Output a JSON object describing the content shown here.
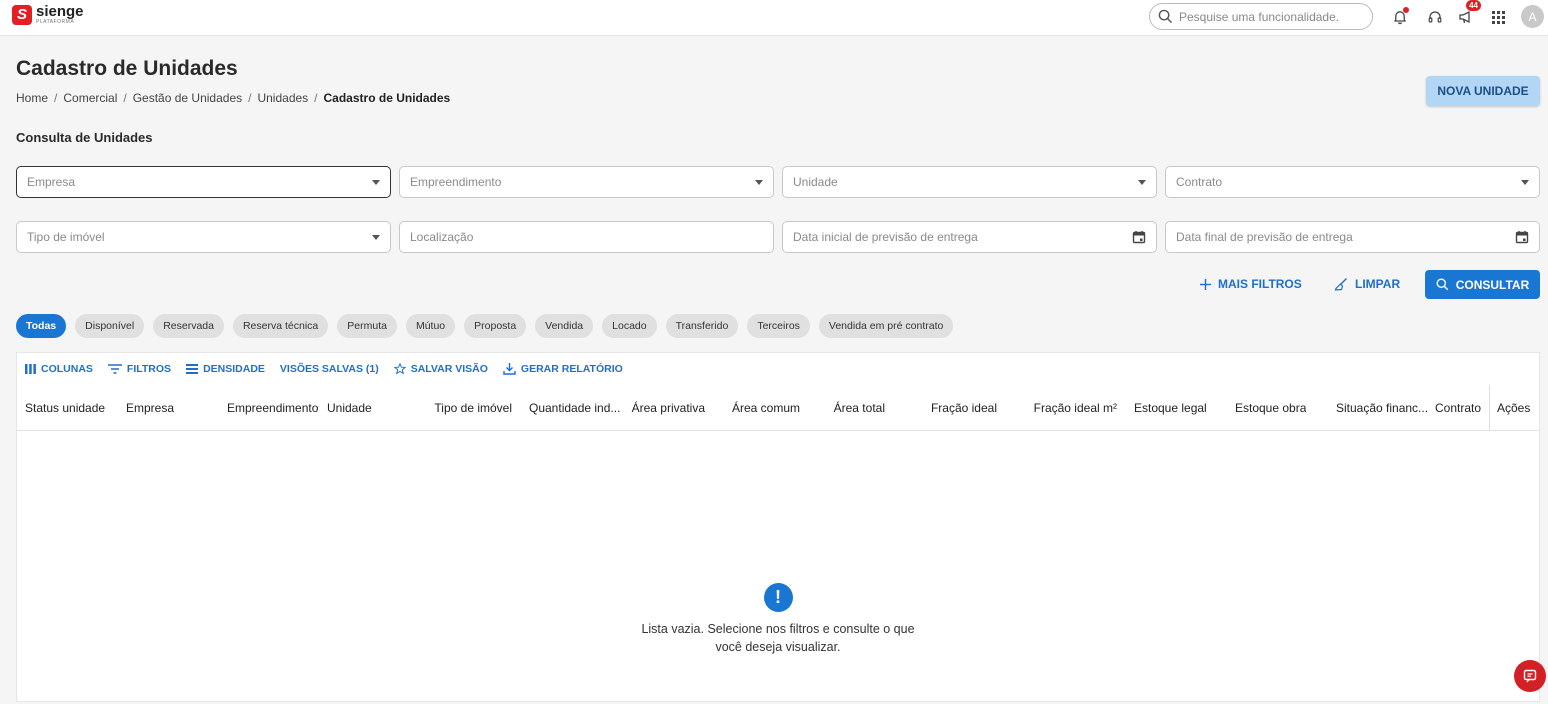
{
  "app": {
    "logo_name": "sienge",
    "logo_sub": "PLATAFORMA",
    "search_placeholder": "Pesquise uma funcionalidade.",
    "announcements_count": "44",
    "avatar_initial": "A"
  },
  "header": {
    "title": "Cadastro de Unidades",
    "breadcrumb": [
      "Home",
      "Comercial",
      "Gestão de Unidades",
      "Unidades",
      "Cadastro de Unidades"
    ],
    "new_button": "NOVA UNIDADE"
  },
  "section_title": "Consulta de Unidades",
  "filters": {
    "empresa": "Empresa",
    "empreendimento": "Empreendimento",
    "unidade": "Unidade",
    "contrato": "Contrato",
    "tipo_imovel": "Tipo de imóvel",
    "localizacao": "Localização",
    "data_inicial": "Data inicial de previsão de entrega",
    "data_final": "Data final de previsão de entrega"
  },
  "actions": {
    "mais_filtros": "MAIS FILTROS",
    "limpar": "LIMPAR",
    "consultar": "CONSULTAR"
  },
  "chips": [
    "Todas",
    "Disponível",
    "Reservada",
    "Reserva técnica",
    "Permuta",
    "Mútuo",
    "Proposta",
    "Vendida",
    "Locado",
    "Transferido",
    "Terceiros",
    "Vendida em pré contrato"
  ],
  "toolbar": {
    "colunas": "COLUNAS",
    "filtros": "FILTROS",
    "densidade": "DENSIDADE",
    "visoes": "VISÕES SALVAS (1)",
    "salvar": "SALVAR VISÃO",
    "relatorio": "GERAR RELATÓRIO"
  },
  "columns": [
    "Status unidade",
    "Empresa",
    "Empreendimento",
    "Unidade",
    "Tipo de imóvel",
    "Quantidade ind...",
    "Área privativa",
    "Área comum",
    "Área total",
    "Fração ideal",
    "Fração ideal m²",
    "Estoque legal",
    "Estoque obra",
    "Situação financ...",
    "Contrato",
    "Ações"
  ],
  "empty": {
    "line1": "Lista vazia. Selecione nos filtros e consulte o que",
    "line2": "você deseja visualizar."
  },
  "colors": {
    "primary": "#1976d2",
    "brand_red": "#e31e24"
  }
}
